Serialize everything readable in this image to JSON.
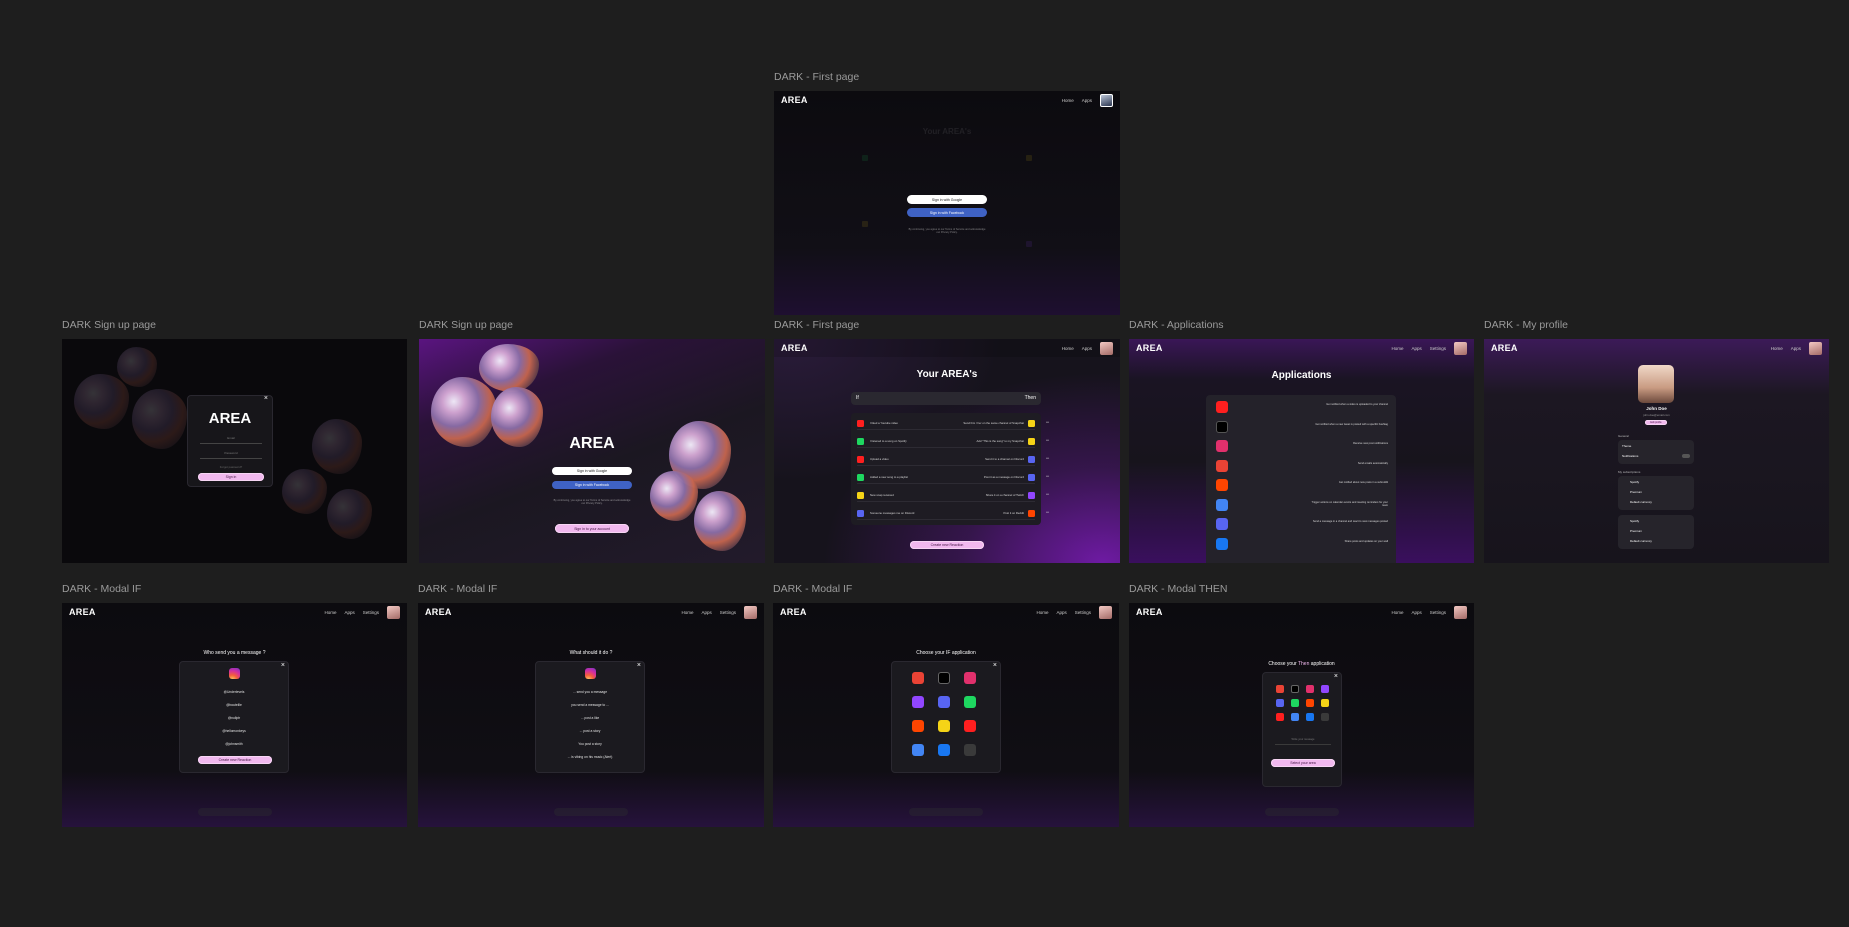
{
  "frames": [
    {
      "label": "DARK - First page"
    },
    {
      "label": "DARK Sign up page"
    },
    {
      "label": "DARK Sign up page"
    },
    {
      "label": "DARK - First page"
    },
    {
      "label": "DARK - Applications"
    },
    {
      "label": "DARK - My profile"
    },
    {
      "label": "DARK - Modal IF"
    },
    {
      "label": "DARK - Modal IF"
    },
    {
      "label": "DARK - Modal IF"
    },
    {
      "label": "DARK - Modal THEN"
    }
  ],
  "app": {
    "logo": "AREA"
  },
  "nav": {
    "home": "Home",
    "apps": "Apps",
    "settings": "Settings"
  },
  "first_page": {
    "bg_title": "Your AREA's",
    "signin_google": "Sign in with Google",
    "signin_facebook": "Sign in with Facebook",
    "legal": "By continuing, you agree to our Terms of Service and acknowledge our Privacy Policy."
  },
  "signup_dim": {
    "title": "AREA",
    "email_placeholder": "Email",
    "password_placeholder": "Password",
    "forgot": "Forgot password?",
    "signin_btn": "Sign in"
  },
  "signup": {
    "title": "AREA",
    "google": "Sign in with Google",
    "facebook": "Sign in with Facebook",
    "legal": "By continuing, you agree to our Terms of Service and acknowledge our Privacy Policy.",
    "login_btn": "Sign in to your account"
  },
  "areas": {
    "title": "Your AREA's",
    "if_label": "If",
    "then_label": "Then",
    "create_btn": "Create new Reaction",
    "rows": [
      {
        "if_color": "#ff1f1f",
        "if_text": "I liked a Youtube video",
        "then_text": "Send him / her on the same channel of Snapchat",
        "then_color": "#f5d417"
      },
      {
        "if_color": "#1ed760",
        "if_text": "I listened to a song on Spotify",
        "then_text": "Add \"This is the song\" to my Snapchat",
        "then_color": "#f5d417"
      },
      {
        "if_color": "#ff1f1f",
        "if_text": "Upload a video",
        "then_text": "Send it to a channel on Discord",
        "then_color": "#5865f2"
      },
      {
        "if_color": "#1ed760",
        "if_text": "Added a new song to a playlist",
        "then_text": "Post it as a message on Discord",
        "then_color": "#5865f2"
      },
      {
        "if_color": "#f5d417",
        "if_text": "New snap received",
        "then_text": "Share it on a channel of Twitch",
        "then_color": "#9146ff"
      },
      {
        "if_color": "#5865f2",
        "if_text": "Someone messages me on Discord",
        "then_text": "Post it on Reddit",
        "then_color": "#ff4500"
      }
    ]
  },
  "applications": {
    "title": "Applications",
    "apps": [
      {
        "name": "youtube-icon",
        "color": "#ff1f1f",
        "desc": "Get notified when a video is uploaded to your channel"
      },
      {
        "name": "x-icon",
        "color": "#000000",
        "desc": "Get notified when a new tweet is posted with a specific hashtag"
      },
      {
        "name": "instagram-icon",
        "color": "#e1306c",
        "desc": "Receive new post notifications"
      },
      {
        "name": "gmail-icon",
        "color": "#ea4335",
        "desc": "Send emails automatically"
      },
      {
        "name": "reddit-icon",
        "color": "#ff4500",
        "desc": "Get notified about new posts in a subreddit"
      },
      {
        "name": "calendar-icon",
        "color": "#4285f4",
        "desc": "Trigger actions on calendar events and meeting reminders for your team"
      },
      {
        "name": "discord-icon",
        "color": "#5865f2",
        "desc": "Send a message in a channel and react to new messages posted"
      },
      {
        "name": "facebook-icon",
        "color": "#1877f2",
        "desc": "Share posts and updates on your wall"
      }
    ]
  },
  "profile": {
    "name": "John Doe",
    "email": "john.doe@email.com",
    "edit_btn": "Edit profile",
    "section1": "General",
    "items1": [
      "Theme",
      "Notifications"
    ],
    "section2": "My subscriptions",
    "items2": [
      "Spotify",
      "Premium",
      "Default currency",
      "Spotify",
      "Premium",
      "Default currency"
    ]
  },
  "modal_if_1": {
    "title": "Who send you a message ?",
    "items": [
      "@Underlevels",
      "@bouteille",
      "@nullptr",
      "@hellomonkeys",
      "@johnsmith"
    ],
    "button": "Create new Reaction"
  },
  "modal_if_2": {
    "title": "What should it do ?",
    "items": [
      "... send you a message",
      "you send a message to ...",
      "... post a like",
      "... post a story",
      "You post a story",
      "... is vibing on his music (Alert)"
    ]
  },
  "modal_if_3": {
    "title": "Choose your IF application",
    "icons": [
      {
        "name": "gmail-icon",
        "color": "#ea4335"
      },
      {
        "name": "x-icon",
        "color": "#000000"
      },
      {
        "name": "instagram-icon",
        "color": "#e1306c"
      },
      {
        "name": "twitch-icon",
        "color": "#9146ff"
      },
      {
        "name": "discord-icon",
        "color": "#5865f2"
      },
      {
        "name": "spotify-icon",
        "color": "#1ed760"
      },
      {
        "name": "reddit-icon",
        "color": "#ff4500"
      },
      {
        "name": "snapchat-icon",
        "color": "#f5d417"
      },
      {
        "name": "youtube-icon",
        "color": "#ff1f1f"
      },
      {
        "name": "calendar-icon",
        "color": "#4285f4"
      },
      {
        "name": "facebook-icon",
        "color": "#1877f2"
      },
      {
        "name": "empty-slot-icon",
        "color": "#3a3a3a"
      }
    ]
  },
  "modal_then": {
    "title_pre": "Choose your ",
    "title_hl": "Then",
    "title_post": " application",
    "field_placeholder": "Write your message",
    "button": "Select your area"
  }
}
